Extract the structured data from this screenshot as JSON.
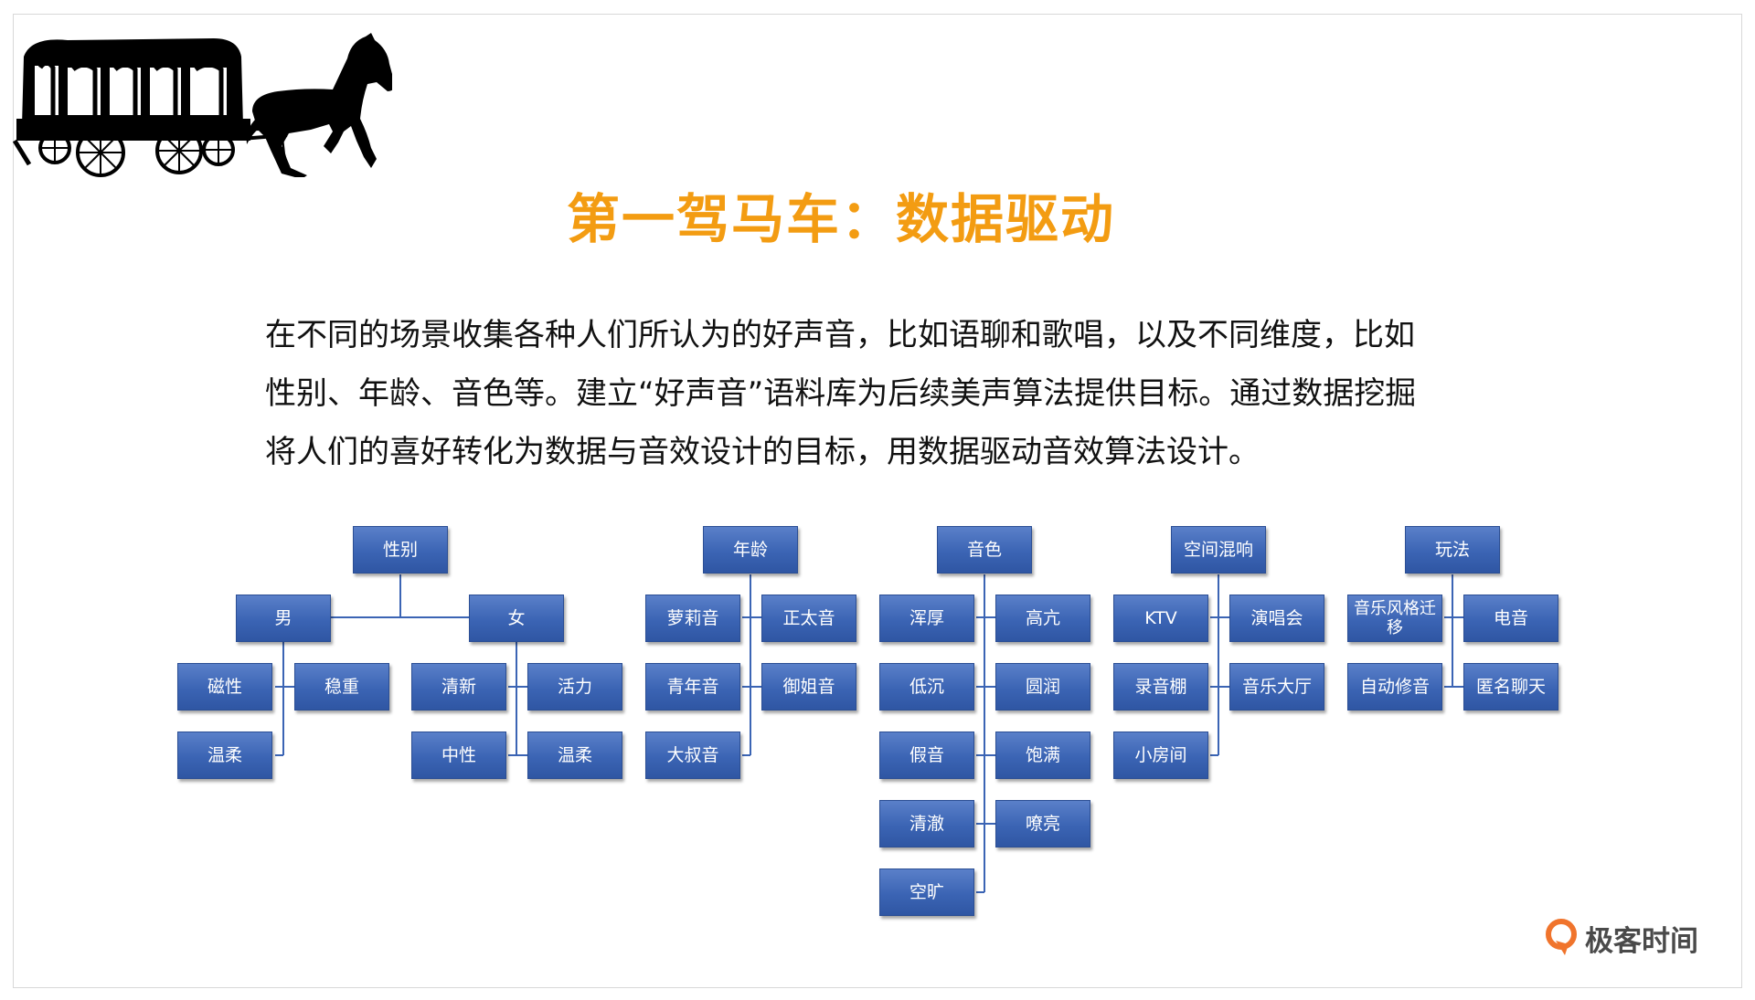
{
  "title": "第一驾马车：数据驱动",
  "description": [
    "在不同的场景收集各种人们所认为的好声音，比如语聊和歌唱，以及不同维度，比如",
    "性别、年龄、音色等。建立“好声音”语料库为后续美声算法提供目标。通过数据挖掘",
    "将人们的喜好转化为数据与音效设计的目标，用数据驱动音效算法设计。"
  ],
  "trees": {
    "gender": {
      "root": "性别",
      "male": {
        "label": "男",
        "items": [
          "磁性",
          "稳重",
          "温柔"
        ]
      },
      "female": {
        "label": "女",
        "items": [
          "清新",
          "活力",
          "中性",
          "温柔"
        ]
      }
    },
    "age": {
      "root": "年龄",
      "items": [
        "萝莉音",
        "正太音",
        "青年音",
        "御姐音",
        "大叔音"
      ]
    },
    "timbre": {
      "root": "音色",
      "items": [
        "浑厚",
        "高亢",
        "低沉",
        "圆润",
        "假音",
        "饱满",
        "清澈",
        "嘹亮",
        "空旷"
      ]
    },
    "reverb": {
      "root": "空间混响",
      "items": [
        "KTV",
        "演唱会",
        "录音棚",
        "音乐大厅",
        "小房间"
      ]
    },
    "play": {
      "root": "玩法",
      "items": [
        "音乐风格迁移",
        "电音",
        "自动修音",
        "匿名聊天"
      ]
    }
  },
  "logo": {
    "text": "极客时间",
    "icon": "geektime-logo-icon",
    "color": "#f0742c"
  },
  "colors": {
    "title": "#f39c12",
    "node": "#3b64b4",
    "line": "#3b64b4"
  }
}
